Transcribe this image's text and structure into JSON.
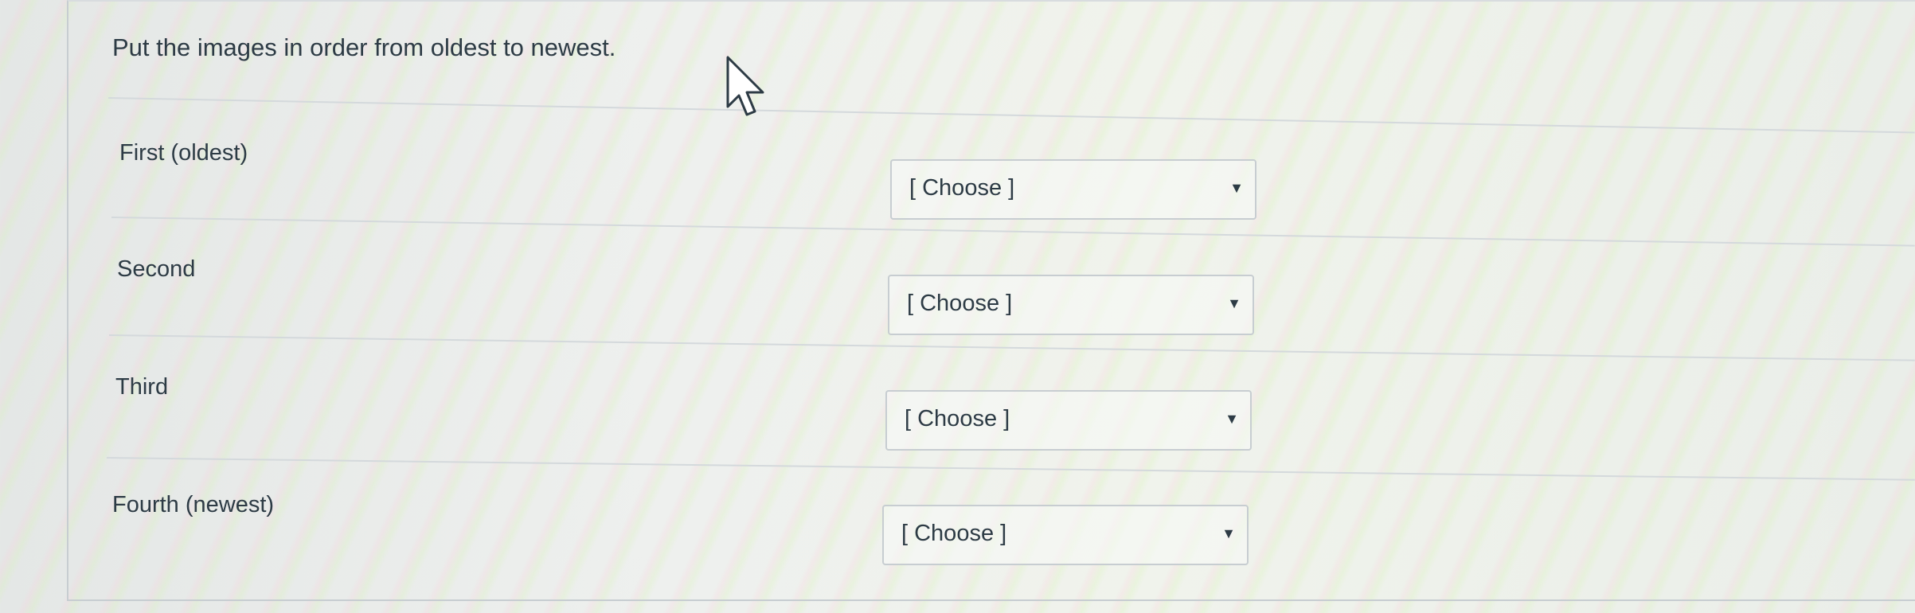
{
  "question": {
    "prompt": "Put the images in order from oldest to newest."
  },
  "rows": [
    {
      "label": "First (oldest)",
      "select_value": "[ Choose ]"
    },
    {
      "label": "Second",
      "select_value": "[ Choose ]"
    },
    {
      "label": "Third",
      "select_value": "[ Choose ]"
    },
    {
      "label": "Fourth (newest)",
      "select_value": "[ Choose ]"
    }
  ],
  "icons": {
    "dropdown": "caret-down-icon",
    "cursor": "mouse-pointer-icon"
  },
  "colors": {
    "text": "#2d3b45",
    "border": "#c7cdd1",
    "background": "#eef0ee"
  }
}
